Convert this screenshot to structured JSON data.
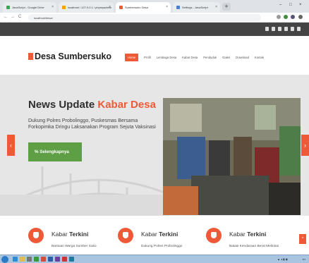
{
  "browser": {
    "tabs": [
      {
        "label": "JavaScript - Google Drive",
        "color": "#34a853"
      },
      {
        "label": "localhost / 127.0.0.1 / phpmyadmin",
        "color": "#f4a300"
      },
      {
        "label": "Sumbersuko Desa",
        "color": "#ee5a37"
      },
      {
        "label": "Settings - JavaScript",
        "color": "#4a7fd6"
      }
    ],
    "new_tab": "+",
    "url": "localhost/desa/",
    "nav": {
      "back": "←",
      "forward": "→",
      "reload": "C"
    }
  },
  "site": {
    "logo": "Desa Sumbersuko",
    "menu": [
      {
        "label": "Home",
        "active": true
      },
      {
        "label": "Profil",
        "active": false
      },
      {
        "label": "Lembaga Desa",
        "active": false
      },
      {
        "label": "Kabar Desa",
        "active": false
      },
      {
        "label": "Penduduk",
        "active": false
      },
      {
        "label": "Galeri",
        "active": false
      },
      {
        "label": "Download",
        "active": false
      },
      {
        "label": "Kontak",
        "active": false
      }
    ],
    "hero": {
      "title_main": "News Update",
      "title_accent": "Kabar Desa",
      "text": "Dukung Polres Probolinggo, Puskesmas Bersama Forkopimka Dringu Laksanakan Program Sejuta Vaksinasi",
      "button": "% Selengkapnya",
      "prev": "‹",
      "next": "›"
    },
    "news": [
      {
        "title_plain": "Kabar",
        "title_bold": "Terkini",
        "sub": "Bantuan Warga Sumber Suko"
      },
      {
        "title_plain": "Kabar",
        "title_bold": "Terkini",
        "sub": "Dukung Polres Probolinggo"
      },
      {
        "title_plain": "Kabar",
        "title_bold": "Terkini",
        "sub": "Batasi Kendaraan Berat Melintas"
      }
    ],
    "scroll_top": "^"
  },
  "colors": {
    "accent": "#ee5a37",
    "button_green": "#5e9e44",
    "topbar": "#444444"
  }
}
